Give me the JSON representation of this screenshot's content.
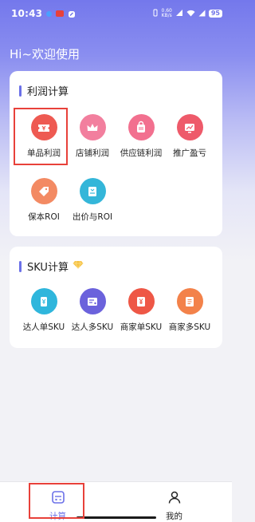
{
  "status_bar": {
    "time": "10:43",
    "net_speed_value": "0.60",
    "net_speed_unit": "KB/s",
    "battery": "95"
  },
  "greeting": "Hi~欢迎使用",
  "profit_section": {
    "title": "利润计算",
    "items": [
      {
        "label": "单品利润",
        "icon": "ticket-icon",
        "color": "#ee5a52"
      },
      {
        "label": "店铺利润",
        "icon": "crown-icon",
        "color": "#f27f9e"
      },
      {
        "label": "供应链利润",
        "icon": "bag-icon",
        "color": "#f2708f"
      },
      {
        "label": "推广盈亏",
        "icon": "chart-icon",
        "color": "#ee5a6a"
      },
      {
        "label": "保本ROI",
        "icon": "tag-icon",
        "color": "#f38a63"
      },
      {
        "label": "出价与ROI",
        "icon": "card-icon",
        "color": "#34b6d9"
      }
    ]
  },
  "sku_section": {
    "title": "SKU计算",
    "items": [
      {
        "label": "达人单SKU",
        "icon": "ticket-yen-icon",
        "color": "#2fb6dc"
      },
      {
        "label": "达人多SKU",
        "icon": "list-card-icon",
        "color": "#6b62dc"
      },
      {
        "label": "商家单SKU",
        "icon": "yen-box-icon",
        "color": "#ee5746"
      },
      {
        "label": "商家多SKU",
        "icon": "document-icon",
        "color": "#f3824a"
      }
    ]
  },
  "tabbar": {
    "calc_label": "计算",
    "mine_label": "我的"
  },
  "colors": {
    "accent": "#6b70e8",
    "highlight": "#e8413a"
  }
}
